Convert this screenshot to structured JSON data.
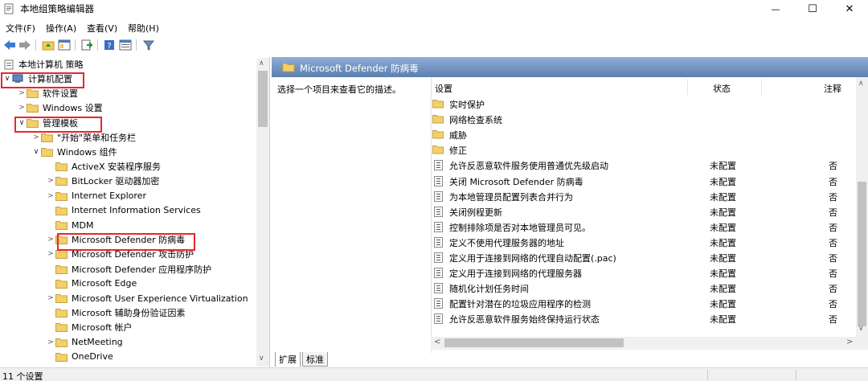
{
  "window": {
    "title": "本地组策略编辑器",
    "minimize_glyph": "—",
    "maximize_glyph": "☐",
    "close_glyph": "✕"
  },
  "menu": [
    "文件(F)",
    "操作(A)",
    "查看(V)",
    "帮助(H)"
  ],
  "toolbar": {
    "icons": [
      "back-arrow-icon",
      "forward-arrow-icon",
      "up-folder-icon",
      "show-hide-tree-icon",
      "export-list-icon",
      "help-icon",
      "properties-icon",
      "filter-icon"
    ]
  },
  "tree": {
    "root": "本地计算机 策略",
    "items": [
      {
        "label": "计算机配置",
        "level": 1,
        "expanded": true,
        "highlight": true
      },
      {
        "label": "软件设置",
        "level": 2,
        "expanded": false
      },
      {
        "label": "Windows 设置",
        "level": 2,
        "expanded": false
      },
      {
        "label": "管理模板",
        "level": 2,
        "expanded": true,
        "highlight": true
      },
      {
        "label": "\"开始\"菜单和任务栏",
        "level": 3,
        "expanded": false
      },
      {
        "label": "Windows 组件",
        "level": 3,
        "expanded": true
      },
      {
        "label": "ActiveX 安装程序服务",
        "level": 4,
        "leaf": true
      },
      {
        "label": "BitLocker 驱动器加密",
        "level": 4,
        "expanded": false
      },
      {
        "label": "Internet Explorer",
        "level": 4,
        "expanded": false
      },
      {
        "label": "Internet Information Services",
        "level": 4,
        "leaf": true
      },
      {
        "label": "MDM",
        "level": 4,
        "leaf": true
      },
      {
        "label": "Microsoft Defender 防病毒",
        "level": 4,
        "expanded": false,
        "highlight": true,
        "selected": true
      },
      {
        "label": "Microsoft Defender 攻击防护",
        "level": 4,
        "expanded": false
      },
      {
        "label": "Microsoft Defender 应用程序防护",
        "level": 4,
        "leaf": true
      },
      {
        "label": "Microsoft Edge",
        "level": 4,
        "leaf": true
      },
      {
        "label": "Microsoft User Experience Virtualization",
        "level": 4,
        "expanded": false
      },
      {
        "label": "Microsoft 辅助身份验证因素",
        "level": 4,
        "leaf": true
      },
      {
        "label": "Microsoft 帐户",
        "level": 4,
        "leaf": true
      },
      {
        "label": "NetMeeting",
        "level": 4,
        "expanded": false
      },
      {
        "label": "OneDrive",
        "level": 4,
        "leaf": true
      }
    ]
  },
  "right": {
    "header_title": "Microsoft Defender 防病毒",
    "description": "选择一个项目来查看它的描述。",
    "columns": {
      "setting": "设置",
      "state": "状态",
      "comment": "注释"
    },
    "folders": [
      "实时保护",
      "网络检查系统",
      "威胁",
      "修正"
    ],
    "policies": [
      {
        "name": "允许反恶意软件服务使用普通优先级启动",
        "state": "未配置",
        "comment": "否"
      },
      {
        "name": "关闭 Microsoft Defender 防病毒",
        "state": "未配置",
        "comment": "否"
      },
      {
        "name": "为本地管理员配置列表合并行为",
        "state": "未配置",
        "comment": "否"
      },
      {
        "name": "关闭例程更新",
        "state": "未配置",
        "comment": "否"
      },
      {
        "name": "控制排除项是否对本地管理员可见。",
        "state": "未配置",
        "comment": "否"
      },
      {
        "name": "定义不使用代理服务器的地址",
        "state": "未配置",
        "comment": "否"
      },
      {
        "name": "定义用于连接到网络的代理自动配置(.pac)",
        "state": "未配置",
        "comment": "否"
      },
      {
        "name": "定义用于连接到网络的代理服务器",
        "state": "未配置",
        "comment": "否"
      },
      {
        "name": "随机化计划任务时间",
        "state": "未配置",
        "comment": "否"
      },
      {
        "name": "配置针对潜在的垃圾应用程序的检测",
        "state": "未配置",
        "comment": "否"
      },
      {
        "name": "允许反恶意软件服务始终保持运行状态",
        "state": "未配置",
        "comment": "否"
      }
    ],
    "tabs": [
      "扩展",
      "标准"
    ]
  },
  "status": {
    "text": "11 个设置"
  },
  "colors": {
    "highlight_border": "#e8262d",
    "header_bg": "#5b7aa6",
    "folder": "#f0c95a"
  }
}
